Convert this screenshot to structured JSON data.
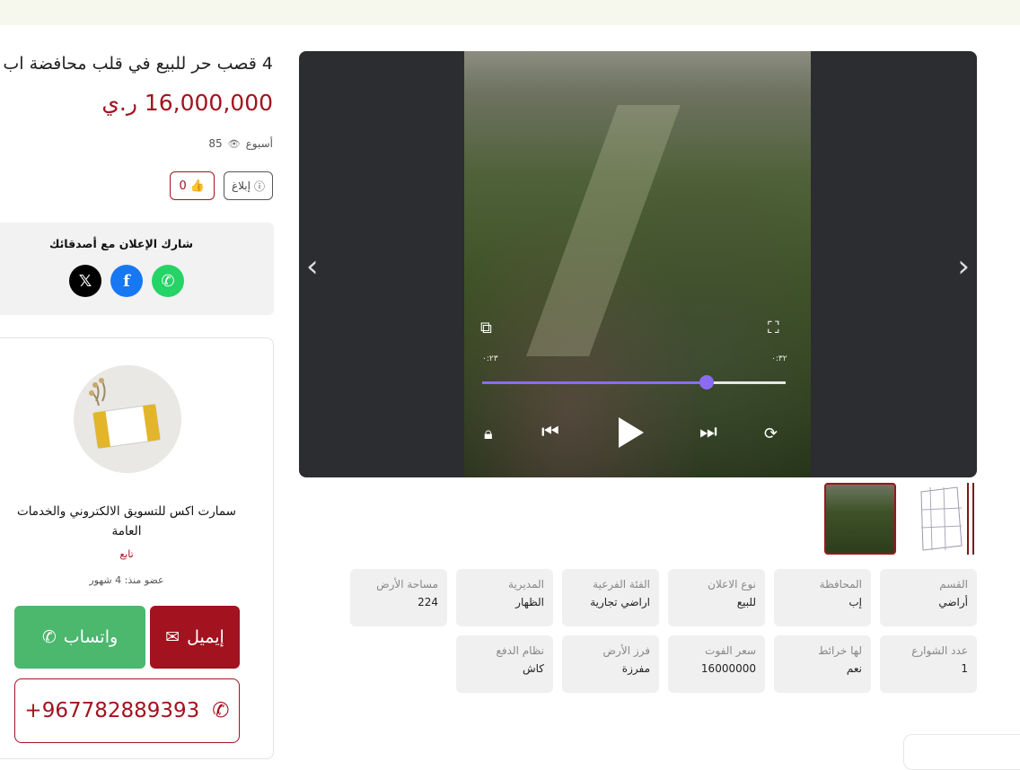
{
  "listing": {
    "title": "4 قصب حر للبيع في قلب محافضة اب",
    "price": "16,000,000 ر.ي",
    "time_ago": "أسبوع",
    "views": "85",
    "report_label": "إبلاغ",
    "likes": "0"
  },
  "share": {
    "title": "شارك الإعلان مع أصدقائك",
    "icons": [
      "x-icon",
      "facebook-icon",
      "whatsapp-icon"
    ]
  },
  "seller": {
    "name": "سمارت اكس للتسويق الالكتروني والخدمات العامة",
    "follow_label": "تابع",
    "member_since": "عضو منذ: 4 شهور",
    "whatsapp_label": "واتساب",
    "email_label": "إيميل",
    "phone": "+967782889393"
  },
  "video": {
    "time_left": "٠:٢٣",
    "time_right": "٠:٣٢",
    "progress": 0.74
  },
  "colors": {
    "brand": "#a3121f",
    "whatsapp": "#4bb86e",
    "progress": "#8a6cf2"
  },
  "details": [
    {
      "label": "القسم",
      "value": "أراضي"
    },
    {
      "label": "المحافظة",
      "value": "إب"
    },
    {
      "label": "نوع الاعلان",
      "value": "للبيع"
    },
    {
      "label": "الفئة الفرعية",
      "value": "اراضي تجارية"
    },
    {
      "label": "المديرية",
      "value": "الظهار"
    },
    {
      "label": "مساحة الأرض",
      "value": "224"
    },
    {
      "label": "عدد الشوارع",
      "value": "1"
    },
    {
      "label": "لها خرائط",
      "value": "نعم"
    },
    {
      "label": "سعر الفوت",
      "value": "16000000"
    },
    {
      "label": "فرز الأرض",
      "value": "مفرزة"
    },
    {
      "label": "نظام الدفع",
      "value": "كاش"
    }
  ]
}
